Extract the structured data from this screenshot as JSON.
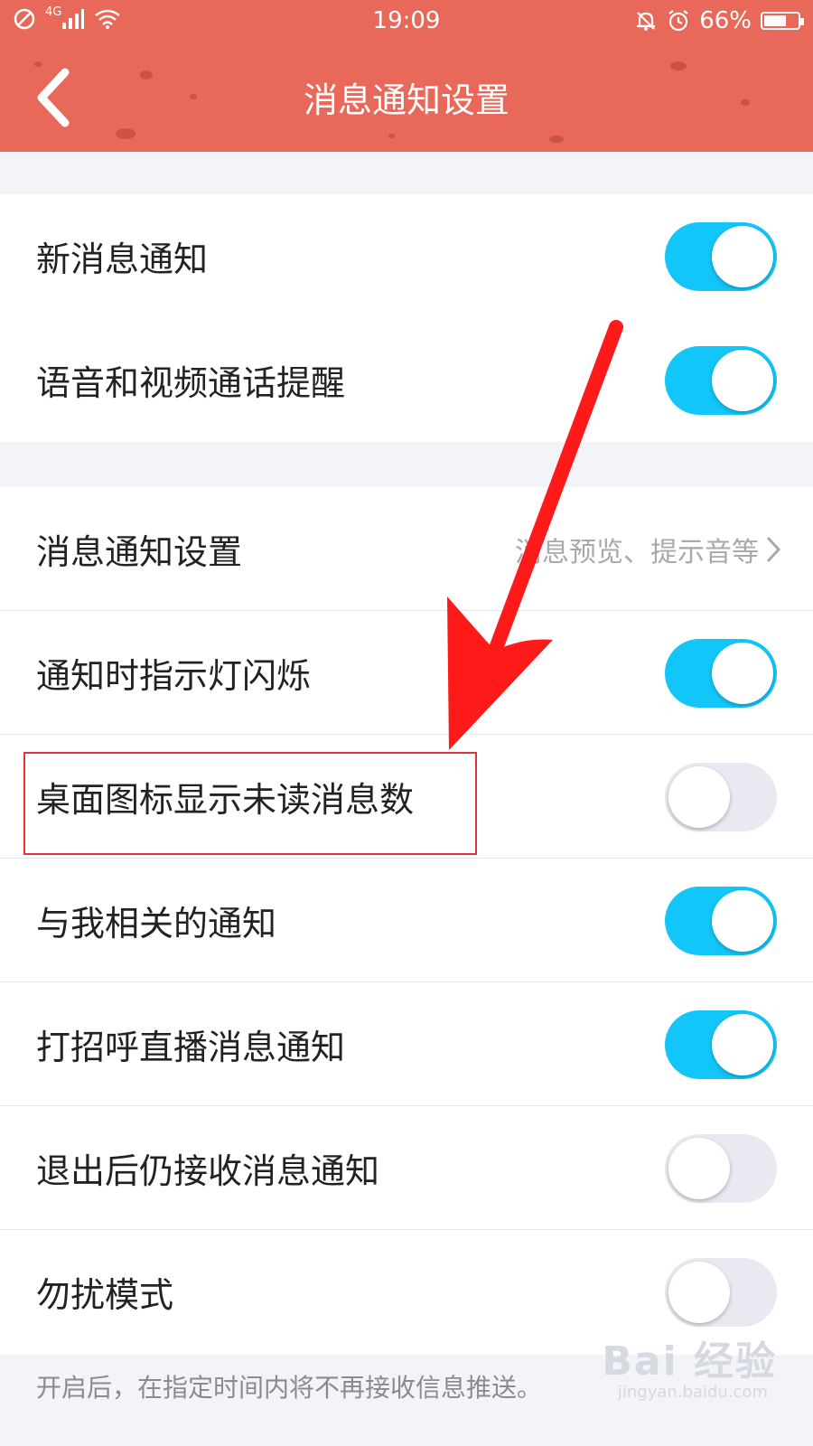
{
  "status_bar": {
    "network": "4G",
    "time": "19:09",
    "battery": "66%",
    "battery_level": 0.66
  },
  "header": {
    "title": "消息通知设置"
  },
  "settings": {
    "group1": [
      {
        "label": "新消息通知",
        "on": true
      },
      {
        "label": "语音和视频通话提醒",
        "on": true
      }
    ],
    "group2": [
      {
        "label": "消息通知设置",
        "value": "消息预览、提示音等",
        "type": "link"
      },
      {
        "label": "通知时指示灯闪烁",
        "on": true
      },
      {
        "label": "桌面图标显示未读消息数",
        "on": false
      },
      {
        "label": "与我相关的通知",
        "on": true
      },
      {
        "label": "打招呼直播消息通知",
        "on": true
      },
      {
        "label": "退出后仍接收消息通知",
        "on": false
      },
      {
        "label": "勿扰模式",
        "on": false
      }
    ]
  },
  "footer_note": "开启后，在指定时间内将不再接收信息推送。",
  "watermark": {
    "text": "Bai 经验",
    "url": "jingyan.baidu.com"
  },
  "colors": {
    "header": "#e8695a",
    "toggle_on": "#12c6fa",
    "toggle_off": "#e8e9f1",
    "annotation": "#e0323a"
  }
}
